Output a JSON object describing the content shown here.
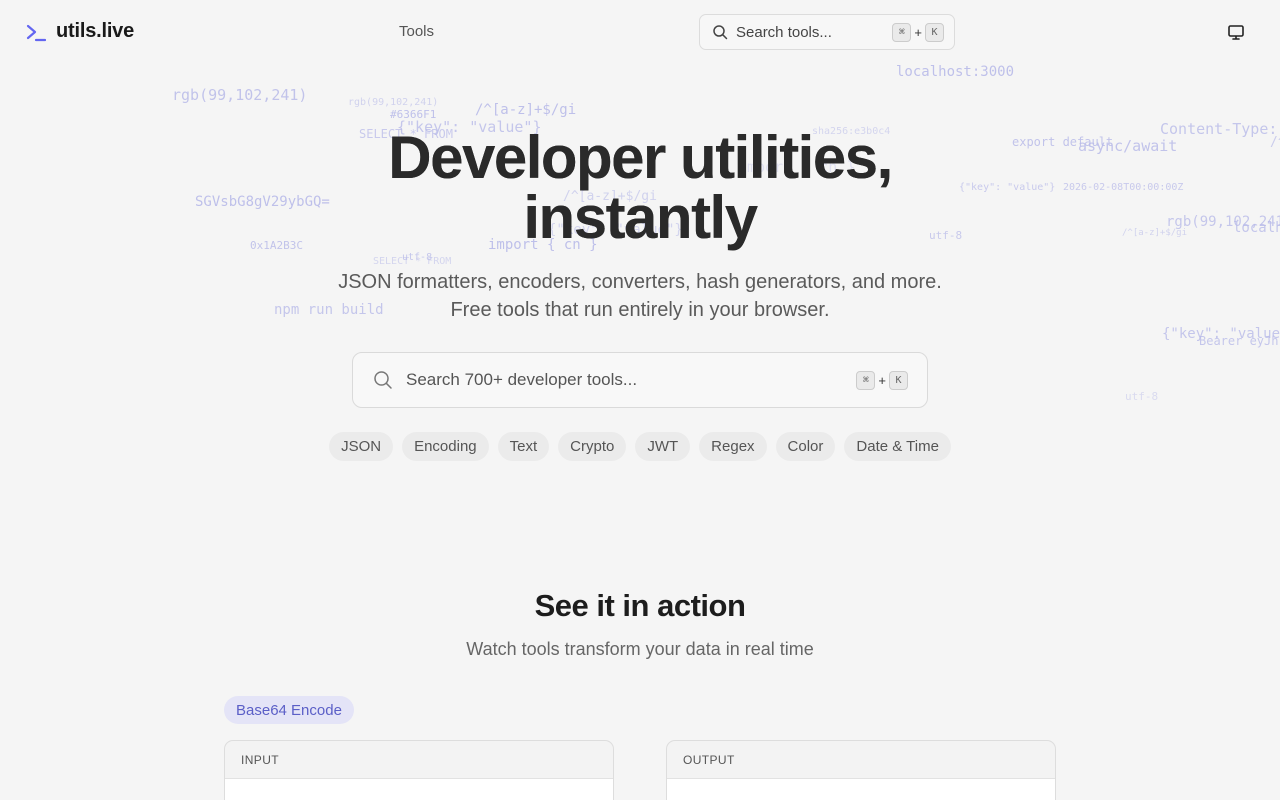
{
  "header": {
    "logo_text": "utils.live",
    "nav_tools": "Tools",
    "search_placeholder": "Search tools...",
    "shortcut_mod": "⌘",
    "shortcut_plus": "+",
    "shortcut_key": "K"
  },
  "snippets": [
    "rgb(99,102,241)",
    "rgb(99,102,241)",
    "#6366F1",
    "SELECT * FROM",
    "{\"key\": \"value\"}",
    "/^[a-z]+$/gi",
    "localhost:3000",
    "sha256:e3b0c4",
    "export default",
    "async/await",
    "Content-Type:",
    "/^",
    "SGVsbG8gV29ybGQ=",
    "/^[a-z]+$/gi",
    "{\"key\": \"value\"}",
    "2026-02-08T00:00:00Z",
    "rgb(99,102,241)",
    "0x1A2B3C",
    "import { cn }",
    "utf-8",
    "SELECT * FROM",
    "utf-8",
    "/^[a-z]+$/gi",
    "localh",
    "npm run build",
    "{\"key\": \"value\"}",
    "Bearer eyJh",
    "import {",
    "utf-8",
    "{\"key\": \"value\"}",
    "import { cn }"
  ],
  "hero": {
    "title_line1": "Developer utilities,",
    "title_line2": "instantly",
    "subtitle_line1": "JSON formatters, encoders, converters, hash generators, and more.",
    "subtitle_line2": "Free tools that run entirely in your browser.",
    "search_placeholder": "Search 700+ developer tools...",
    "shortcut_mod": "⌘",
    "shortcut_plus": "+",
    "shortcut_key": "K",
    "categories": [
      "JSON",
      "Encoding",
      "Text",
      "Crypto",
      "JWT",
      "Regex",
      "Color",
      "Date & Time"
    ]
  },
  "demo": {
    "title": "See it in action",
    "subtitle": "Watch tools transform your data in real time",
    "badge": "Base64 Encode",
    "input_label": "INPUT",
    "output_label": "OUTPUT"
  },
  "colors": {
    "accent": "#6366F1",
    "background": "#F5F5F5",
    "badge_bg": "#E4E4F7"
  }
}
